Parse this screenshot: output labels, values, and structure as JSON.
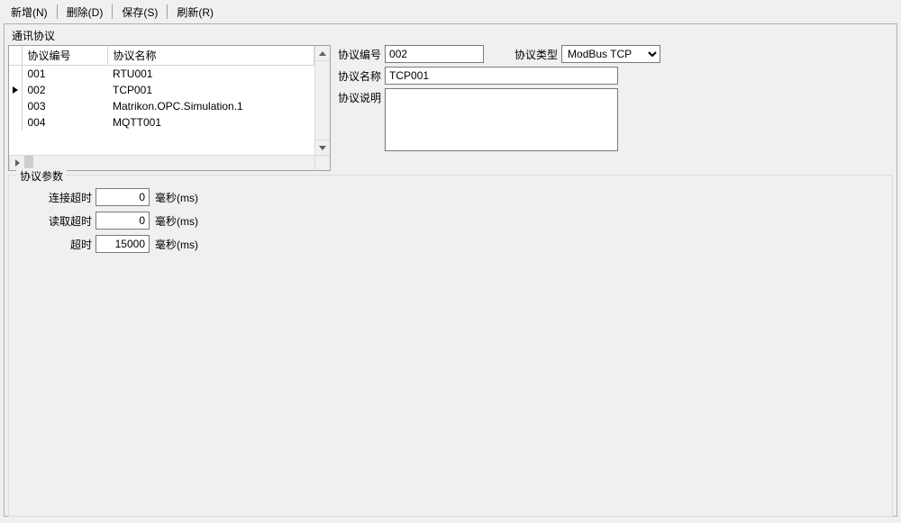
{
  "toolbar": {
    "add": "新增(N)",
    "delete": "删除(D)",
    "save": "保存(S)",
    "refresh": "刷新(R)"
  },
  "section": {
    "title": "通讯协议",
    "params_title": "协议参数"
  },
  "grid": {
    "columns": {
      "code": "协议编号",
      "name": "协议名称"
    },
    "rows": [
      {
        "code": "001",
        "name": "RTU001",
        "current": false
      },
      {
        "code": "002",
        "name": "TCP001",
        "current": true
      },
      {
        "code": "003",
        "name": "Matrikon.OPC.Simulation.1",
        "current": false
      },
      {
        "code": "004",
        "name": "MQTT001",
        "current": false
      }
    ]
  },
  "detail": {
    "code_label": "协议编号",
    "code_value": "002",
    "type_label": "协议类型",
    "type_value": "ModBus TCP",
    "name_label": "协议名称",
    "name_value": "TCP001",
    "desc_label": "协议说明",
    "desc_value": ""
  },
  "params": {
    "conn_timeout_label": "连接超时",
    "conn_timeout_value": "0",
    "read_timeout_label": "读取超时",
    "read_timeout_value": "0",
    "timeout_label": "超时",
    "timeout_value": "15000",
    "unit": "毫秒(ms)"
  }
}
